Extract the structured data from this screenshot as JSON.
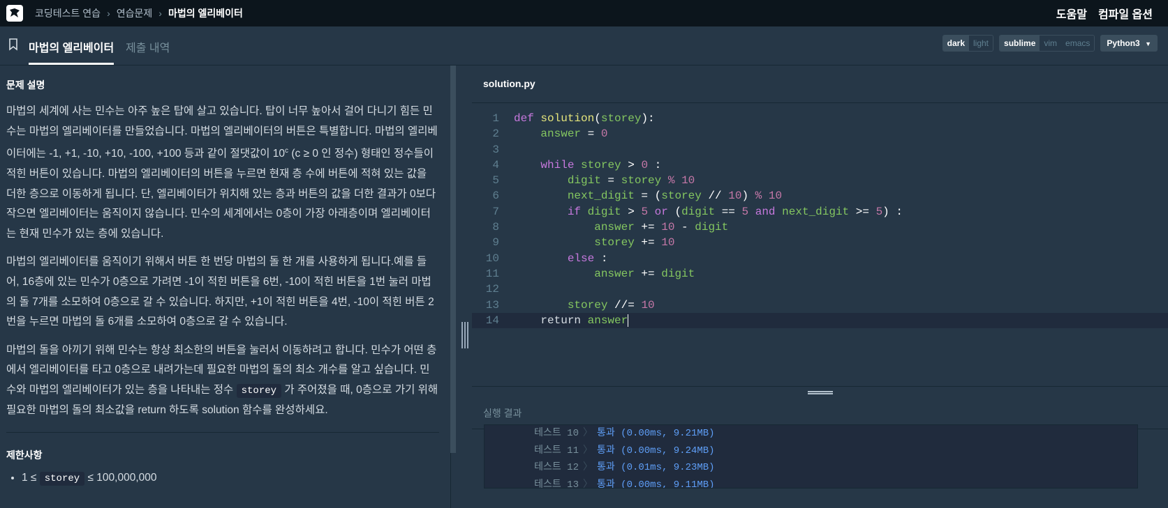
{
  "nav": {
    "breadcrumbs": [
      "코딩테스트 연습",
      "연습문제",
      "마법의 엘리베이터"
    ],
    "help": "도움말",
    "compile_options": "컴파일 옵션"
  },
  "tabs": {
    "active": "마법의 엘리베이터",
    "history": "제출 내역"
  },
  "toggles": {
    "themes": [
      "dark",
      "light"
    ],
    "keymaps": [
      "sublime",
      "vim",
      "emacs"
    ],
    "language": "Python3"
  },
  "problem": {
    "section_title": "문제 설명",
    "p1_a": "마법의 세계에 사는 민수는 아주 높은 탑에 살고 있습니다. 탑이 너무 높아서 걸어 다니기 힘든 민수는 마법의 엘리베이터를 만들었습니다. 마법의 엘리베이터의 버튼은 특별합니다. 마법의 엘리베이터에는 -1, +1, -10, +10, -100, +100 등과 같이 절댓값이 10",
    "p1_sup": "c",
    "p1_b": " (c ≥ 0 인 정수) 형태인 정수들이 적힌 버튼이 있습니다. 마법의 엘리베이터의 버튼을 누르면 현재 층 수에 버튼에 적혀 있는 값을 더한 층으로 이동하게 됩니다. 단, 엘리베이터가 위치해 있는 층과 버튼의 값을 더한 결과가 0보다 작으면 엘리베이터는 움직이지 않습니다. 민수의 세계에서는 0층이 가장 아래층이며 엘리베이터는 현재 민수가 있는 층에 있습니다.",
    "p2": "마법의 엘리베이터를 움직이기 위해서 버튼 한 번당 마법의 돌 한 개를 사용하게 됩니다.예를 들어, 16층에 있는 민수가 0층으로 가려면 -1이 적힌 버튼을 6번, -10이 적힌 버튼을 1번 눌러 마법의 돌 7개를 소모하여 0층으로 갈 수 있습니다. 하지만, +1이 적힌 버튼을 4번, -10이 적힌 버튼 2번을 누르면 마법의 돌 6개를 소모하여 0층으로 갈 수 있습니다.",
    "p3_a": "마법의 돌을 아끼기 위해 민수는 항상 최소한의 버튼을 눌러서 이동하려고 합니다. 민수가 어떤 층에서 엘리베이터를 타고 0층으로 내려가는데 필요한 마법의 돌의 최소 개수를 알고 싶습니다. 민수와 마법의 엘리베이터가 있는 층을 나타내는 정수 ",
    "p3_code": "storey",
    "p3_b": " 가 주어졌을 때, 0층으로 가기 위해 필요한 마법의 돌의 최소값을 return 하도록 solution 함수를 완성하세요.",
    "limits_title": "제한사항",
    "limit_pre": "1 ≤ ",
    "limit_code": "storey",
    "limit_post": " ≤ 100,000,000"
  },
  "editor": {
    "filename": "solution.py",
    "line_numbers": [
      "1",
      "2",
      "3",
      "4",
      "5",
      "6",
      "7",
      "8",
      "9",
      "10",
      "11",
      "12",
      "13",
      "14"
    ]
  },
  "result": {
    "title": "실행 결과",
    "rows": [
      {
        "label": "테스트 10",
        "value": "통과 (0.00ms, 9.21MB)"
      },
      {
        "label": "테스트 11",
        "value": "통과 (0.00ms, 9.24MB)"
      },
      {
        "label": "테스트 12",
        "value": "통과 (0.01ms, 9.23MB)"
      },
      {
        "label": "테스트 13",
        "value": "통과 (0.00ms, 9.11MB)"
      }
    ]
  },
  "colors": {
    "background": "#263747",
    "topbar": "#0c151c",
    "pass": "#5e9ef6"
  }
}
